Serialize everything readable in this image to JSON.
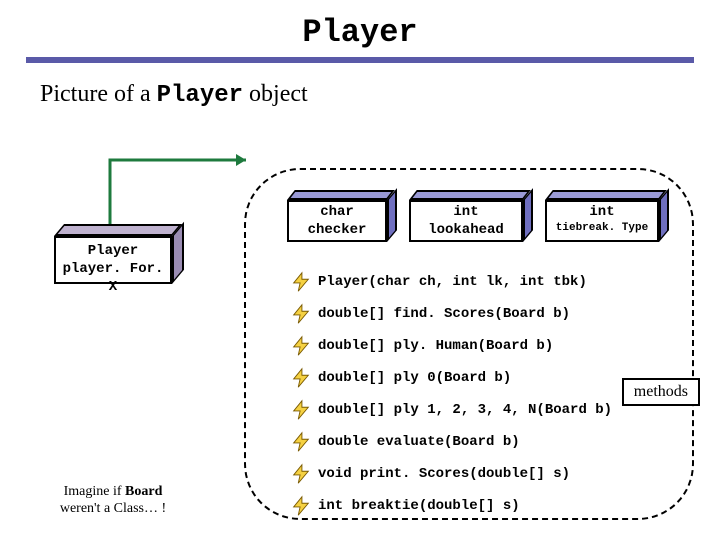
{
  "title": "Player",
  "subtitle_prefix": "Picture of a ",
  "subtitle_code": "Player",
  "subtitle_suffix": " object",
  "reference": {
    "line1": "Player",
    "line2": "player. For. X"
  },
  "fields": [
    {
      "type": "char",
      "name": "checker"
    },
    {
      "type": "int",
      "name": "lookahead"
    },
    {
      "type": "int",
      "name": "tiebreak. Type"
    }
  ],
  "methods": [
    "Player(char ch, int lk, int tbk)",
    "double[] find. Scores(Board b)",
    "double[] ply. Human(Board b)",
    "double[] ply 0(Board b)",
    "double[] ply 1, 2, 3, 4, N(Board b)",
    "double evaluate(Board b)",
    "void print. Scores(double[] s)",
    "int breaktie(double[] s)"
  ],
  "methods_label": "methods",
  "footnote": {
    "p1": "Imagine if ",
    "b": "Board",
    "p2": " weren't a Class… !"
  }
}
